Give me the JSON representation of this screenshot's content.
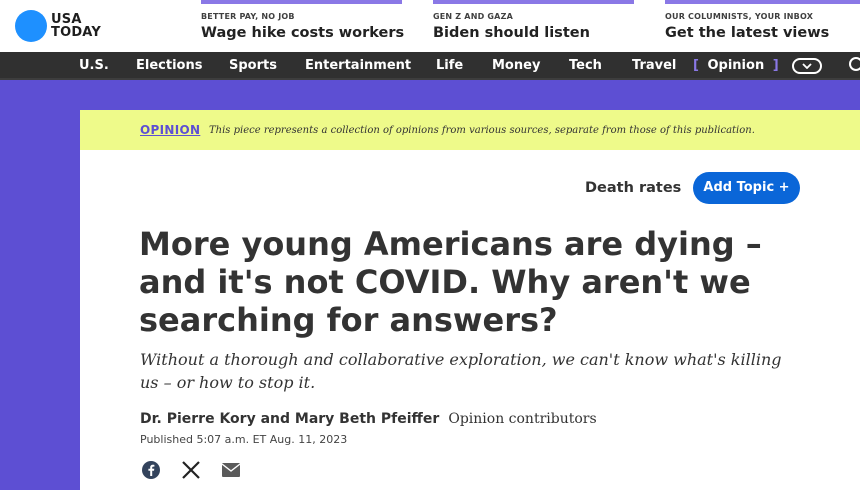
{
  "logo": {
    "line1": "USA",
    "line2": "TODAY"
  },
  "promos": [
    {
      "kicker": "BETTER PAY, NO JOB",
      "title": "Wage hike costs workers"
    },
    {
      "kicker": "GEN Z AND GAZA",
      "title": "Biden should listen"
    },
    {
      "kicker": "OUR COLUMNISTS, YOUR INBOX",
      "title": "Get the latest views"
    }
  ],
  "nav": {
    "items": [
      "U.S.",
      "Elections",
      "Sports",
      "Entertainment",
      "Life",
      "Money",
      "Tech",
      "Travel"
    ],
    "active": "Opinion",
    "bracket_open": "[",
    "bracket_close": "]"
  },
  "banner": {
    "label": "OPINION",
    "note": "This piece represents a collection of opinions from various sources, separate from those of this publication."
  },
  "topic": {
    "label": "Death rates",
    "add_button": "Add Topic +"
  },
  "article": {
    "headline": "More young Americans are dying – and it's not COVID. Why aren't we searching for answers?",
    "subhead": "Without a thorough and collaborative exploration, we can't know what's killing us – or how to stop it.",
    "authors": "Dr. Pierre Kory and Mary Beth Pfeiffer",
    "role": "Opinion contributors",
    "published": "Published 5:07 a.m. ET Aug. 11, 2023"
  },
  "colors": {
    "accent": "#5d4fd3",
    "banner": "#eefa8a",
    "button": "#0a66d8",
    "nav": "#303030"
  }
}
